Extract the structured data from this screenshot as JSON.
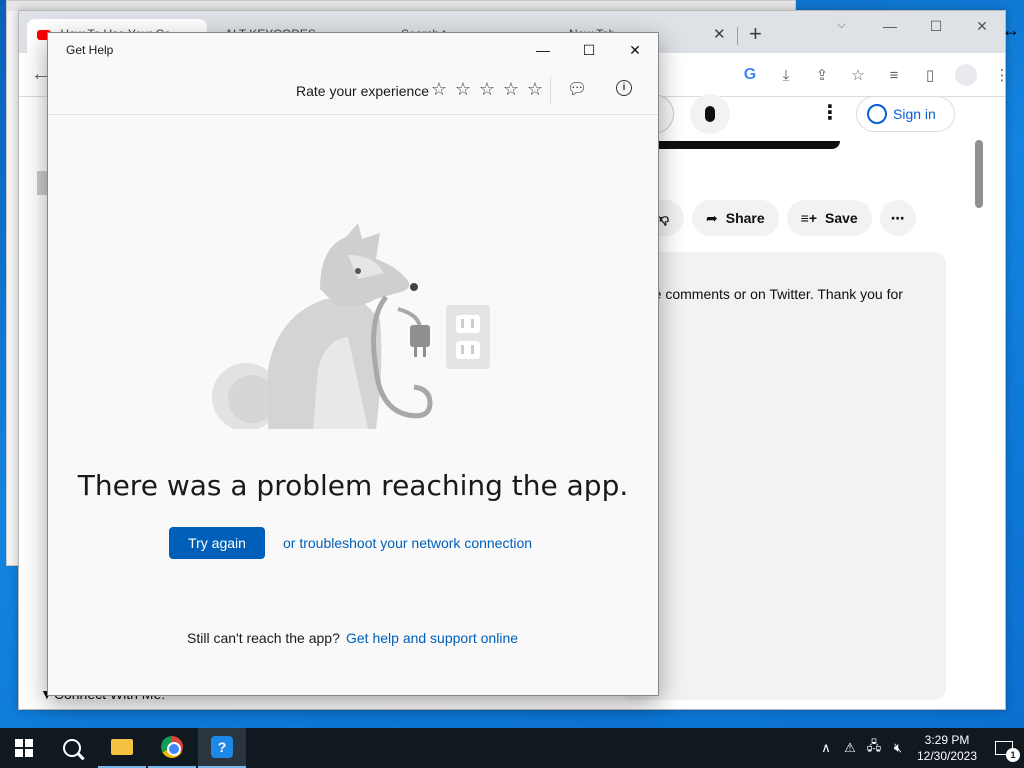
{
  "browser": {
    "tabs": [
      {
        "title": "How To Use Your Ca",
        "active": true
      },
      {
        "title": "ALT KEYCODES"
      },
      {
        "title": "Search t"
      },
      {
        "title": "New Tab"
      }
    ],
    "tab_close": "✕",
    "new_tab": "+",
    "window_controls": {
      "minimize": "—",
      "maximize": "☐",
      "close": "✕"
    },
    "tab_search": "⌵"
  },
  "youtube": {
    "sign_in": "Sign in",
    "actions": [
      {
        "icon": "thumbs-down-icon",
        "label": ""
      },
      {
        "icon": "share-icon",
        "label": "Share"
      },
      {
        "icon": "save-icon",
        "label": "Save"
      },
      {
        "icon": "more-icon",
        "label": "⋯"
      }
    ],
    "description_text": "the comments or on Twitter. Thank you for",
    "connect_text": "▼Connect With Me:"
  },
  "dialog": {
    "title": "Get Help",
    "rate_label": "Rate your experience",
    "stars": [
      "☆",
      "☆",
      "☆",
      "☆",
      "☆"
    ],
    "heading": "There was a problem reaching the app.",
    "try_again": "Try again",
    "troubleshoot_link": "or troubleshoot your network connection",
    "still_text": "Still can't reach the app?",
    "help_link": "Get help and support online",
    "controls": {
      "minimize": "—",
      "maximize": "☐",
      "close": "✕"
    }
  },
  "taskbar": {
    "apps": [
      "search-icon",
      "file-explorer-icon",
      "chrome-icon",
      "get-help-icon"
    ],
    "clock_time": "3:29 PM",
    "clock_date": "12/30/2023",
    "notification_count": "1"
  },
  "colors": {
    "accent": "#005fb8",
    "youtube_link": "#065fd4",
    "taskbar": "#101820"
  }
}
